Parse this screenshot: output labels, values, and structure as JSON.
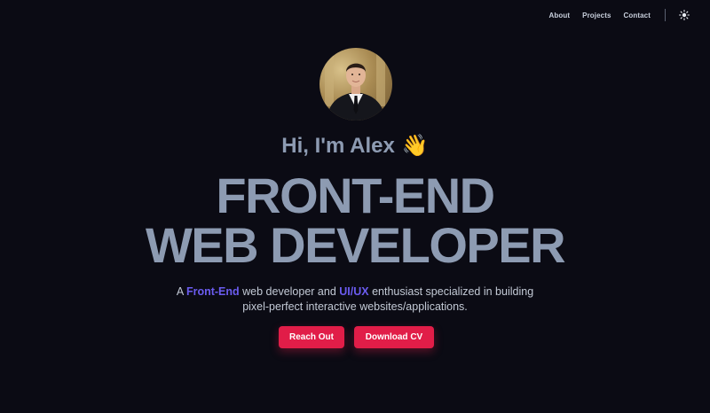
{
  "nav": {
    "links": [
      "About",
      "Projects",
      "Contact"
    ],
    "theme_toggle_icon": "sun-icon"
  },
  "hero": {
    "avatar_icon": "profile-photo",
    "greeting": "Hi, I'm Alex",
    "wave_emoji": "👋",
    "headline_line1": "FRONT-END",
    "headline_line2": "WEB DEVELOPER",
    "description": {
      "part1": "A ",
      "highlight1": "Front-End",
      "part2": " web developer and ",
      "highlight2": "UI/UX",
      "part3": " enthusiast specialized in building",
      "line2": "pixel-perfect interactive websites/applications."
    },
    "buttons": {
      "reach_out": "Reach Out",
      "download_cv": "Download CV"
    }
  },
  "colors": {
    "background": "#0b0b14",
    "headline": "#8d9bb2",
    "accent": "#6b5cf0",
    "button": "#e11d48"
  }
}
